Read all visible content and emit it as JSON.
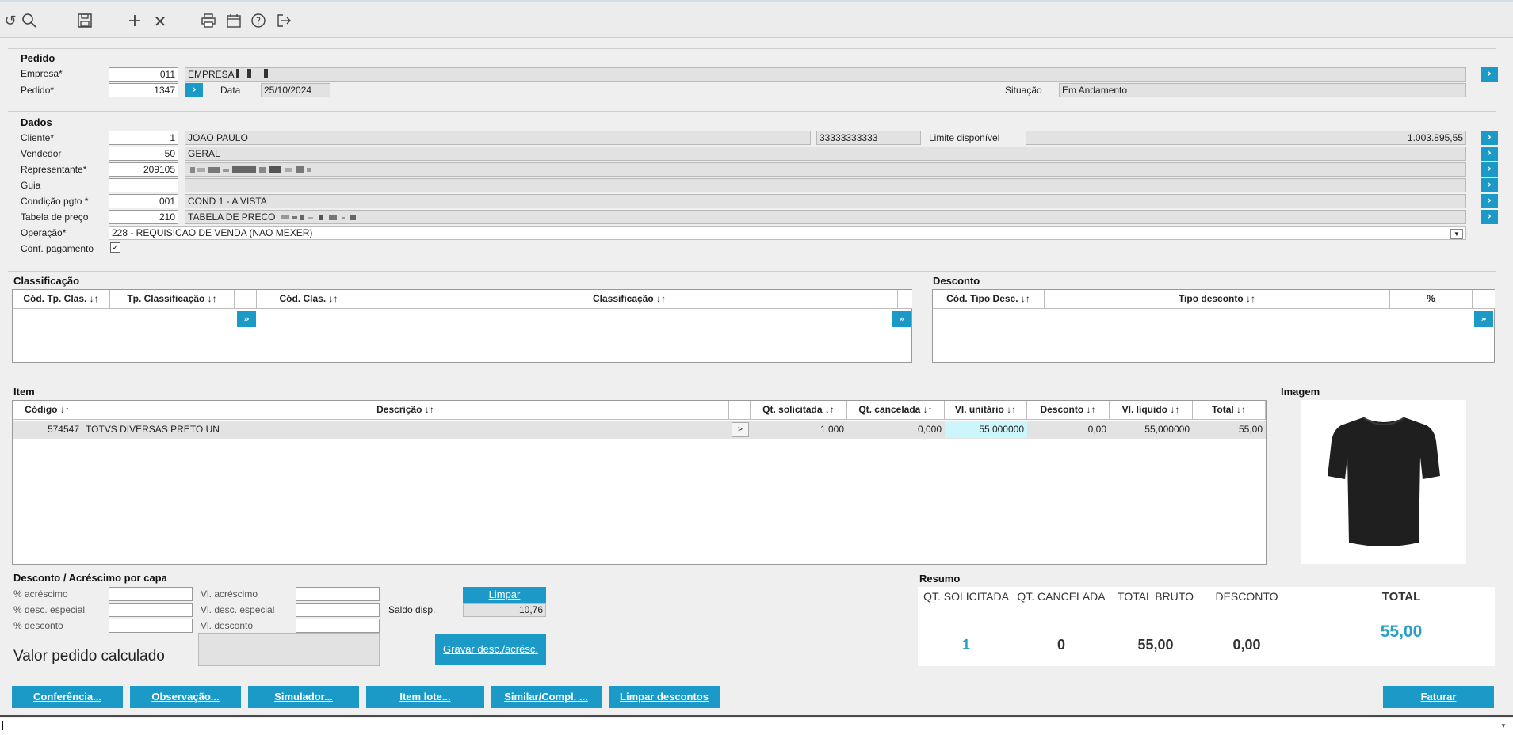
{
  "toolbar": {
    "icons": [
      "undo-icon",
      "search-icon",
      "save-icon",
      "add-icon",
      "close-icon",
      "print-icon",
      "calendar-icon",
      "help-icon",
      "exit-icon"
    ]
  },
  "pedido": {
    "title": "Pedido",
    "empresa_label": "Empresa*",
    "empresa_code": "011",
    "empresa_name": "EMPRESA",
    "pedido_label": "Pedido*",
    "pedido_value": "1347",
    "data_label": "Data",
    "data_value": "25/10/2024",
    "situacao_label": "Situação",
    "situacao_value": "Em Andamento"
  },
  "dados": {
    "title": "Dados",
    "cliente_label": "Cliente*",
    "cliente_code": "1",
    "cliente_name": "JOAO PAULO",
    "cliente_doc": "33333333333",
    "limite_label": "Limite disponível",
    "limite_value": "1.003.895,55",
    "vendedor_label": "Vendedor",
    "vendedor_code": "50",
    "vendedor_name": "GERAL",
    "representante_label": "Representante*",
    "representante_code": "209105",
    "guia_label": "Guia",
    "condicao_label": "Condição pgto *",
    "condicao_code": "001",
    "condicao_name": "COND 1 - A VISTA",
    "tabela_label": "Tabela de preço",
    "tabela_code": "210",
    "tabela_name": "TABELA DE PRECO",
    "operacao_label": "Operação*",
    "operacao_value": "228 - REQUISICAO DE VENDA (NAO MEXER)",
    "conf_label": "Conf. pagamento",
    "conf_checked": true
  },
  "classificacao": {
    "title": "Classificação",
    "columns": [
      "Cód. Tp. Clas. ↓↑",
      "Tp. Classificação ↓↑",
      "Cód. Clas. ↓↑",
      "Classificação ↓↑"
    ]
  },
  "desconto": {
    "title": "Desconto",
    "columns": [
      "Cód. Tipo Desc. ↓↑",
      "Tipo desconto ↓↑",
      "%"
    ]
  },
  "item": {
    "title": "Item",
    "columns": [
      "Código ↓↑",
      "Descrição ↓↑",
      "Qt. solicitada ↓↑",
      "Qt. cancelada ↓↑",
      "Vl. unitário ↓↑",
      "Desconto ↓↑",
      "Vl. líquido ↓↑",
      "Total ↓↑"
    ],
    "rows": [
      {
        "codigo": "574547",
        "descricao": "TOTVS DIVERSAS PRETO UN",
        "qt_solicitada": "1,000",
        "qt_cancelada": "0,000",
        "vl_unitario": "55,000000",
        "desconto": "0,00",
        "vl_liquido": "55,000000",
        "total": "55,00"
      }
    ]
  },
  "imagem": {
    "title": "Imagem",
    "icon": "tshirt-image"
  },
  "desc_acresc": {
    "title": "Desconto / Acréscimo por capa",
    "pct_acrescimo": "% acréscimo",
    "pct_desc_especial": "% desc. especial",
    "pct_desconto": "% desconto",
    "vl_acrescimo": "Vl. acréscimo",
    "vl_desc_especial": "Vl. desc. especial",
    "vl_desconto": "Vl. desconto",
    "limpar_label": "Limpar",
    "saldo_label": "Saldo disp.",
    "saldo_value": "10,76",
    "gravar_label": "Gravar desc./acrésc.",
    "valor_calc_label": "Valor pedido calculado"
  },
  "resumo": {
    "title": "Resumo",
    "h_qt_solicitada": "QT. SOLICITADA",
    "h_qt_cancelada": "QT. CANCELADA",
    "h_total_bruto": "TOTAL BRUTO",
    "h_desconto": "DESCONTO",
    "h_total": "TOTAL",
    "qt_solicitada": "1",
    "qt_cancelada": "0",
    "total_bruto": "55,00",
    "desconto": "0,00",
    "total": "55,00"
  },
  "buttons": {
    "conferencia": "Conferência...",
    "observacao": "Observação...",
    "simulador": "Simulador...",
    "item_lote": "Item lote...",
    "similar": "Similar/Compl. ...",
    "limpar_descontos": "Limpar descontos",
    "faturar": "Faturar"
  },
  "colors": {
    "accent": "#1c9ac7",
    "highlight_cell": "#ccf6fb",
    "total_value": "#2a9fc4"
  }
}
